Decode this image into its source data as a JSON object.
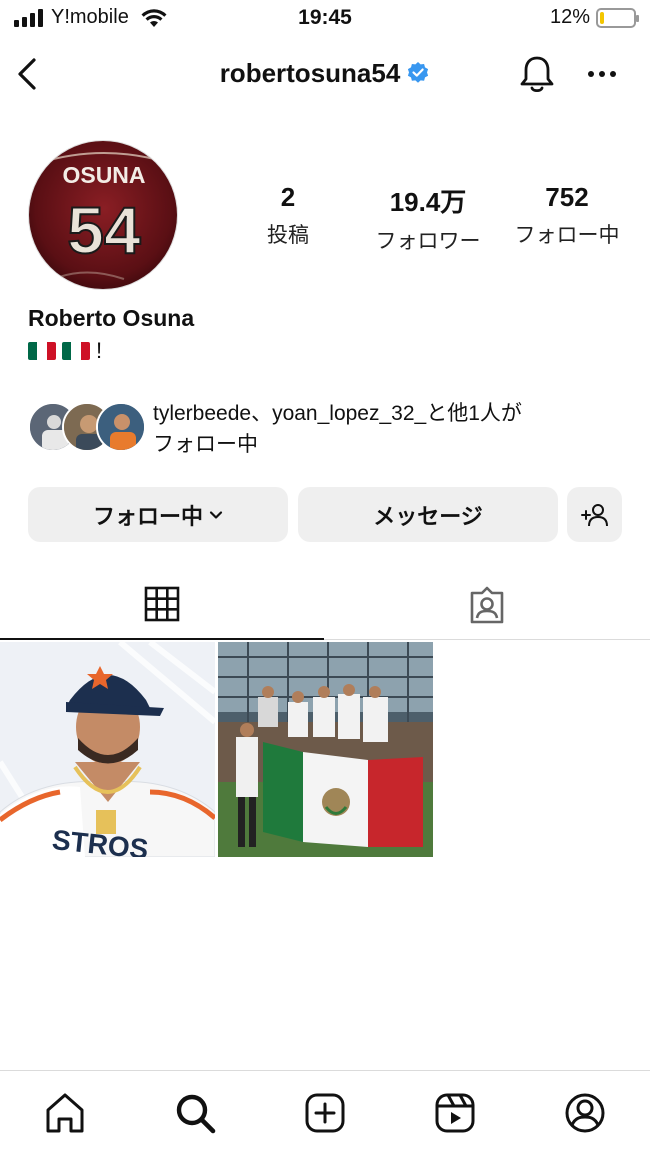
{
  "status_bar": {
    "carrier": "Y!mobile",
    "time": "19:45",
    "battery_percent": "12%",
    "battery_level": 0.12
  },
  "header": {
    "username": "robertosuna54",
    "verified": true
  },
  "profile": {
    "avatar_jersey_name": "OSUNA",
    "avatar_jersey_number": "54",
    "stats": {
      "posts_count": "2",
      "posts_label": "投稿",
      "followers_count": "19.4万",
      "followers_label": "フォロワー",
      "following_count": "752",
      "following_label": "フォロー中"
    },
    "full_name": "Roberto Osuna",
    "bio_suffix": "!",
    "mutual_followers_line1": "tylerbeede、yoan_lopez_32_と他1人が",
    "mutual_followers_line2": "フォロー中"
  },
  "actions": {
    "following_label": "フォロー中",
    "message_label": "メッセージ"
  },
  "colors": {
    "accent_verified": "#3897f0",
    "button_bg": "#efefef",
    "battery_low": "#f3c600",
    "flag_green": "#006847",
    "flag_red": "#ce1126"
  },
  "icons": {
    "back": "chevron-left-icon",
    "bell": "bell-icon",
    "more": "more-horizontal-icon",
    "grid_tab": "grid-icon",
    "tagged_tab": "tagged-user-icon",
    "nav": [
      "home-icon",
      "search-icon",
      "create-icon",
      "reels-icon",
      "profile-icon"
    ]
  }
}
